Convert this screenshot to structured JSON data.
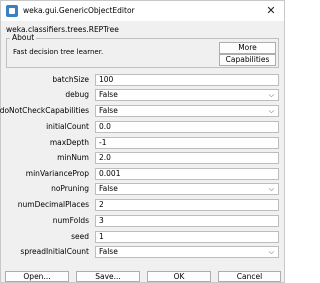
{
  "window": {
    "title": "weka.gui.GenericObjectEditor",
    "close_label": "✕"
  },
  "classname": "weka.classifiers.trees.REPTree",
  "about": {
    "title": "About",
    "text": "Fast decision tree learner.",
    "more_label": "More",
    "capabilities_label": "Capabilities"
  },
  "params": [
    {
      "label": "batchSize",
      "value": "100",
      "kind": "text"
    },
    {
      "label": "debug",
      "value": "False",
      "kind": "select"
    },
    {
      "label": "doNotCheckCapabilities",
      "value": "False",
      "kind": "select"
    },
    {
      "label": "initialCount",
      "value": "0.0",
      "kind": "text"
    },
    {
      "label": "maxDepth",
      "value": "-1",
      "kind": "text"
    },
    {
      "label": "minNum",
      "value": "2.0",
      "kind": "text"
    },
    {
      "label": "minVarianceProp",
      "value": "0.001",
      "kind": "text"
    },
    {
      "label": "noPruning",
      "value": "False",
      "kind": "select"
    },
    {
      "label": "numDecimalPlaces",
      "value": "2",
      "kind": "text"
    },
    {
      "label": "numFolds",
      "value": "3",
      "kind": "text"
    },
    {
      "label": "seed",
      "value": "1",
      "kind": "text"
    },
    {
      "label": "spreadInitialCount",
      "value": "False",
      "kind": "select"
    }
  ],
  "chevron": "⌵",
  "footer": {
    "open_label": "Open...",
    "save_label": "Save...",
    "ok_label": "OK",
    "cancel_label": "Cancel"
  }
}
